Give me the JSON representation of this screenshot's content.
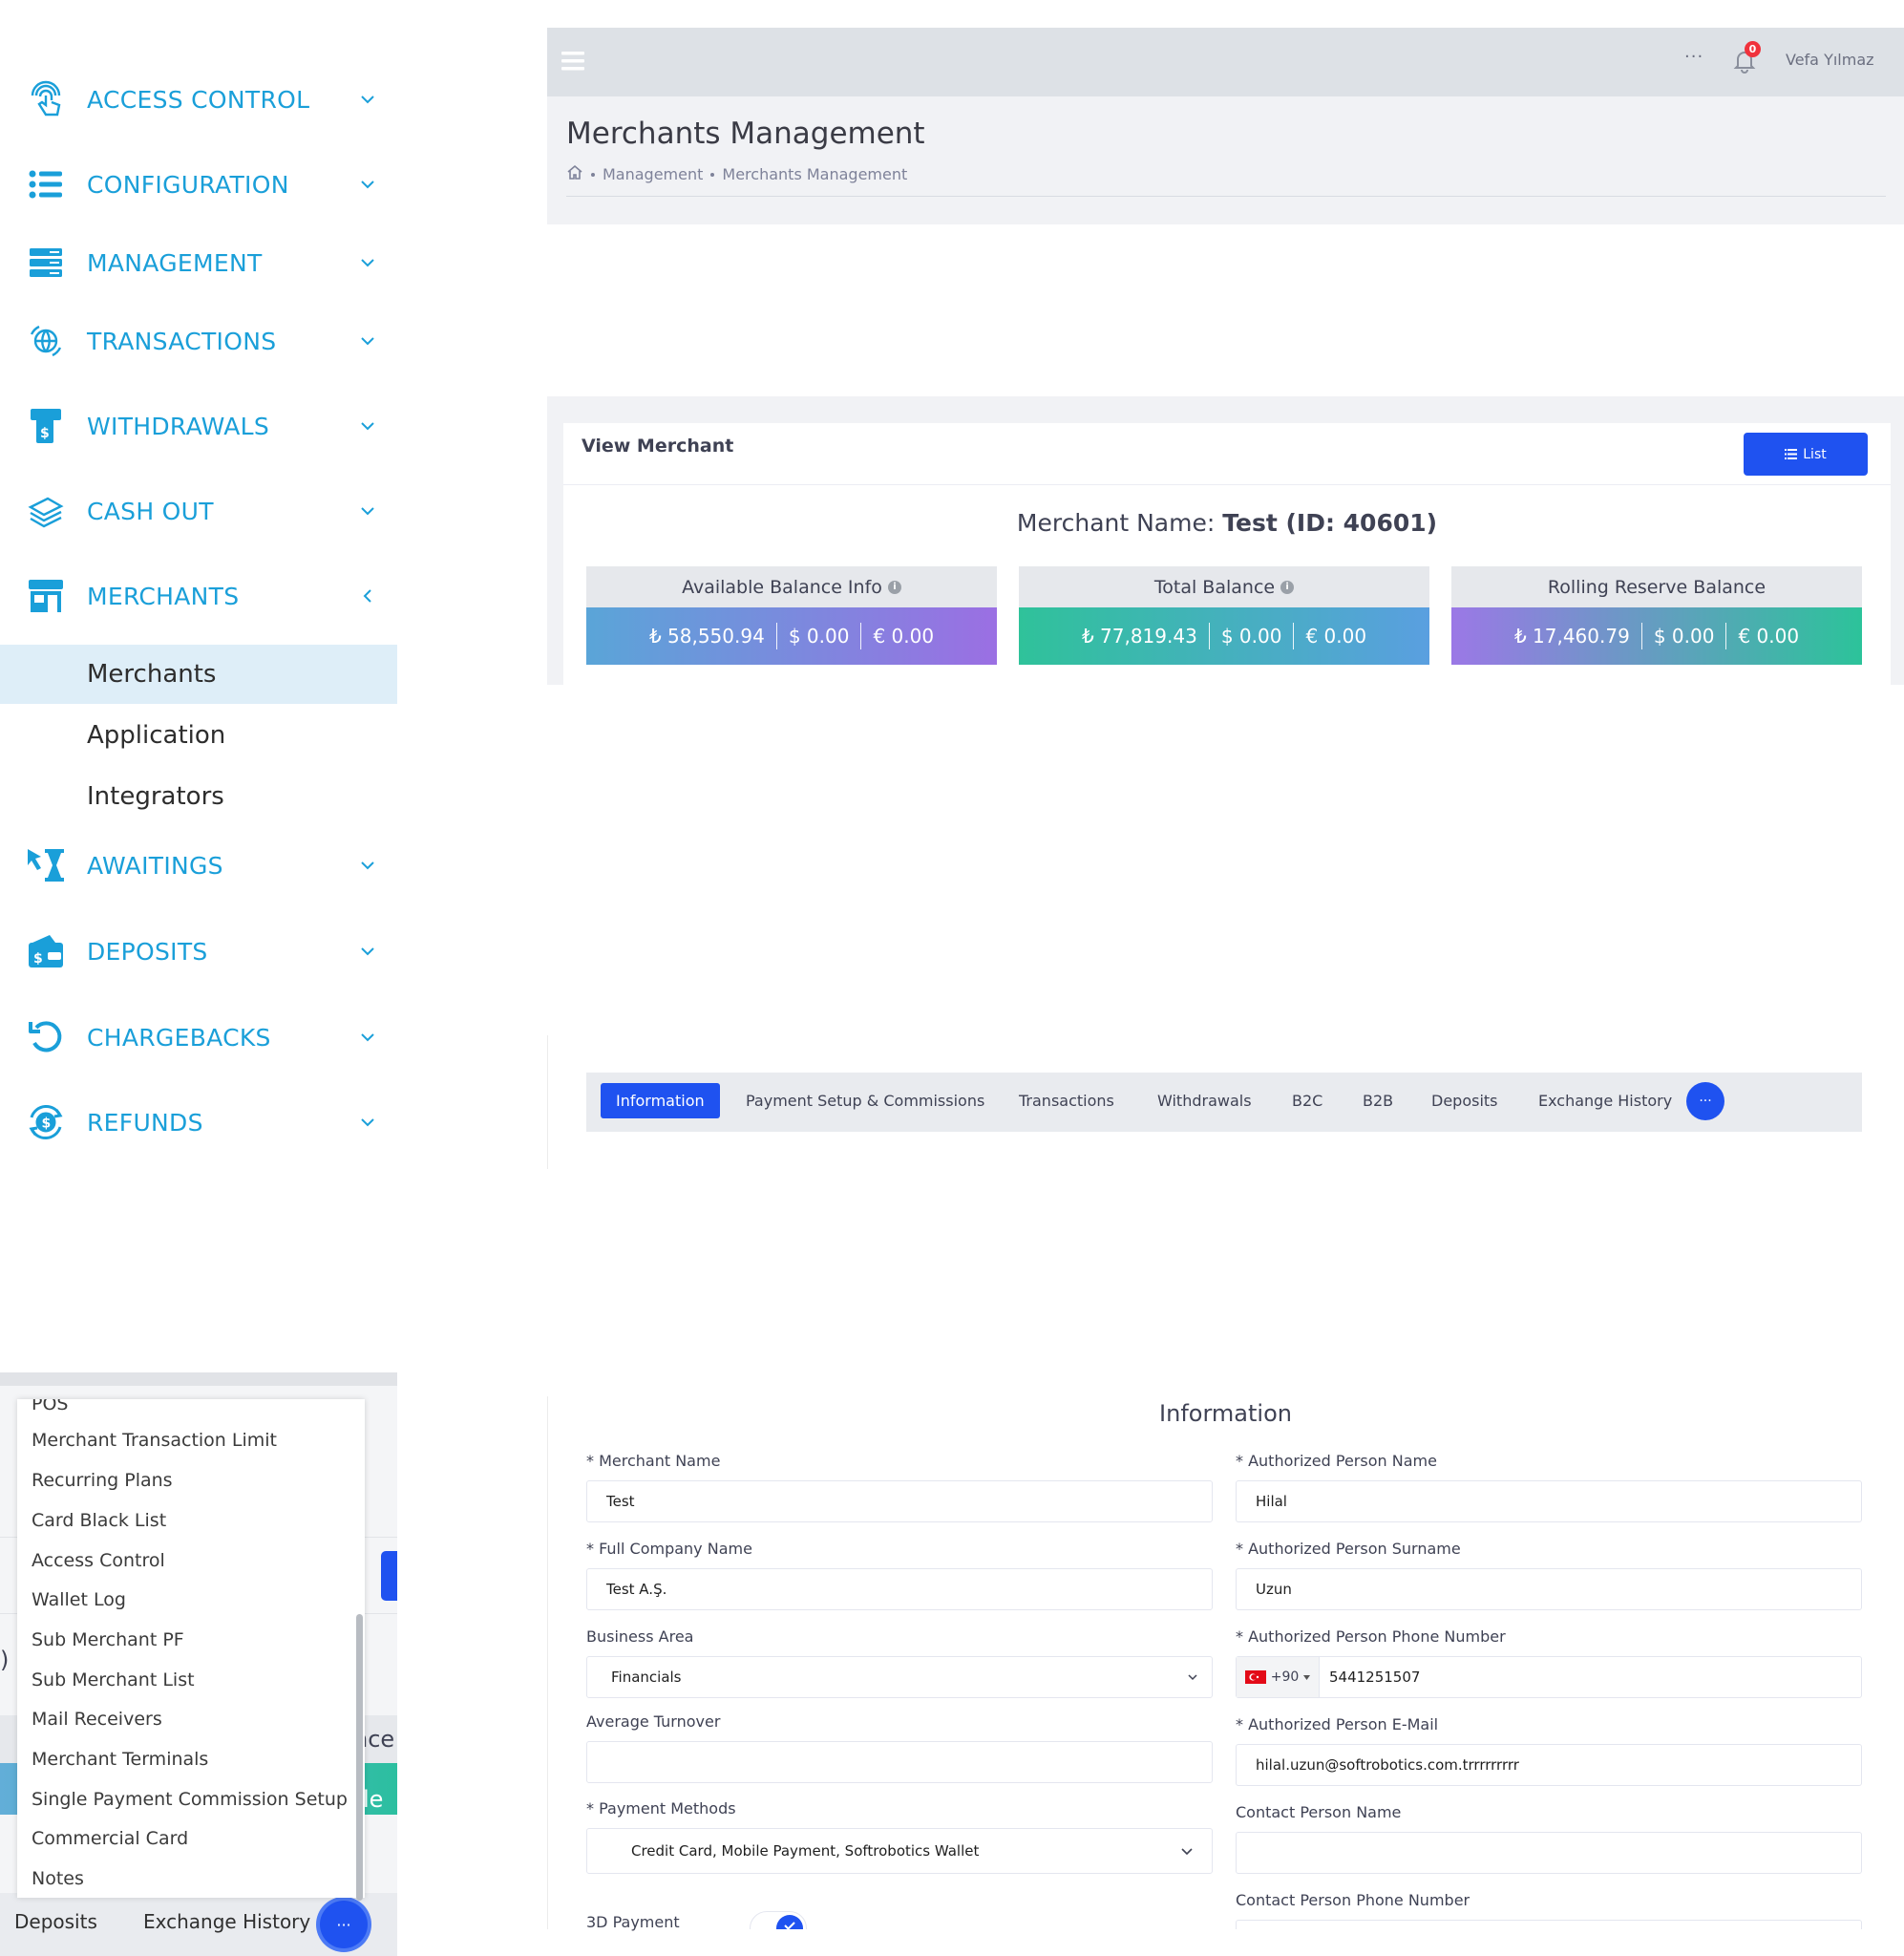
{
  "sidebar": {
    "items": [
      {
        "label": "ACCESS CONTROL",
        "icon": "fingerprint-touch-icon"
      },
      {
        "label": "CONFIGURATION",
        "icon": "list-icon"
      },
      {
        "label": "MANAGEMENT",
        "icon": "server-icon"
      },
      {
        "label": "TRANSACTIONS",
        "icon": "globe-transfer-icon"
      },
      {
        "label": "WITHDRAWALS",
        "icon": "atm-icon"
      },
      {
        "label": "CASH OUT",
        "icon": "cash-stack-icon"
      },
      {
        "label": "MERCHANTS",
        "icon": "store-icon"
      },
      {
        "label": "AWAITINGS",
        "icon": "hourglass-cursor-icon"
      },
      {
        "label": "DEPOSITS",
        "icon": "wallet-dollar-icon"
      },
      {
        "label": "CHARGEBACKS",
        "icon": "undo-arrow-icon"
      },
      {
        "label": "REFUNDS",
        "icon": "refund-dollar-icon"
      }
    ],
    "merchants_sub": [
      "Merchants",
      "Application",
      "Integrators"
    ]
  },
  "header": {
    "more": "···",
    "notification_count": "0",
    "user_name": "Vefa Yılmaz"
  },
  "page": {
    "title": "Merchants Management",
    "breadcrumb": [
      "Management",
      "Merchants Management"
    ]
  },
  "view_merchant": {
    "title": "View Merchant",
    "list_button": "List",
    "merchant_name_label": "Merchant Name:",
    "merchant_name_value": "Test (ID: 40601)",
    "balances": [
      {
        "title": "Available Balance Info",
        "info": true,
        "try": "₺ 58,550.94",
        "usd": "$ 0.00",
        "eur": "€ 0.00",
        "gradient": [
          "#5aa5d8",
          "#9b6fe3"
        ]
      },
      {
        "title": "Total Balance",
        "info": true,
        "try": "₺ 77,819.43",
        "usd": "$ 0.00",
        "eur": "€ 0.00",
        "gradient": [
          "#2fc29a",
          "#5a9fe0"
        ]
      },
      {
        "title": "Rolling Reserve Balance",
        "info": false,
        "try": "₺ 17,460.79",
        "usd": "$ 0.00",
        "eur": "€ 0.00",
        "gradient": [
          "#9b78e6",
          "#2cc39a"
        ]
      }
    ]
  },
  "tabs": [
    "Information",
    "Payment Setup & Commissions",
    "Transactions",
    "Withdrawals",
    "B2C",
    "B2B",
    "Deposits",
    "Exchange History"
  ],
  "tabs_more": "···",
  "dropdown": {
    "items": [
      "POS",
      "Merchant Transaction Limit",
      "Recurring Plans",
      "Card Black List",
      "Access Control",
      "Wallet Log",
      "Sub Merchant PF",
      "Sub Merchant List",
      "Mail Receivers",
      "Merchant Terminals",
      "Single Payment Commission Setup",
      "Commercial Card",
      "Notes"
    ],
    "bottom_tabs": [
      "Deposits",
      "Exchange History"
    ],
    "edge_texts": [
      "nce",
      "le",
      ")"
    ]
  },
  "information": {
    "title": "Information",
    "fields_left": [
      {
        "label": "* Merchant Name",
        "value": "Test"
      },
      {
        "label": "* Full Company Name",
        "value": "Test A.Ş."
      },
      {
        "label": "Business Area",
        "value": "Financials"
      },
      {
        "label": "Average Turnover",
        "value": ""
      },
      {
        "label": "* Payment Methods",
        "value": "Credit Card, Mobile Payment, Softrobotics Wallet"
      },
      {
        "label": "3D Payment",
        "value": ""
      }
    ],
    "fields_right": [
      {
        "label": "* Authorized Person Name",
        "value": "Hilal"
      },
      {
        "label": "* Authorized Person Surname",
        "value": "Uzun"
      },
      {
        "label": "* Authorized Person Phone Number",
        "value": "5441251507",
        "dial_code": "+90"
      },
      {
        "label": "* Authorized Person E-Mail",
        "value": "hilal.uzun@softrobotics.com.trrrrrrrrr"
      },
      {
        "label": "Contact Person Name",
        "value": ""
      },
      {
        "label": "Contact Person Phone Number",
        "value": ""
      }
    ]
  },
  "colors": {
    "accent": "#1f52f0",
    "sidebar_text": "#1a9fd9",
    "active_sub_bg": "#deeef8"
  }
}
